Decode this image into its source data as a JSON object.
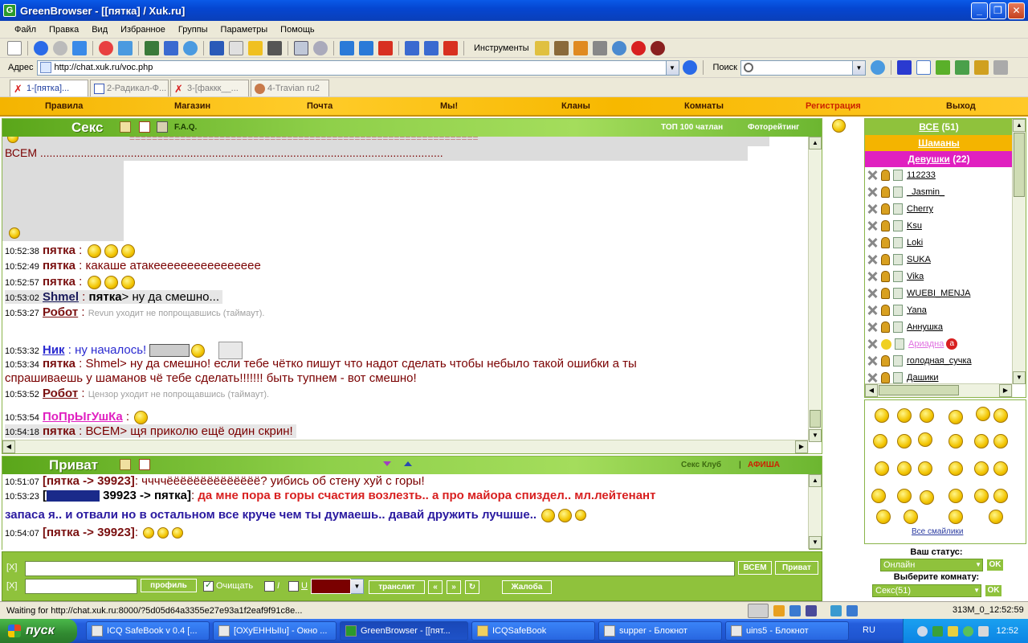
{
  "window": {
    "title": "GreenBrowser - [[пятка] / Xuk.ru]",
    "app_icon": "G"
  },
  "menu": [
    "Файл",
    "Правка",
    "Вид",
    "Избранное",
    "Группы",
    "Параметры",
    "Помощь"
  ],
  "toolbar": {
    "tools_label": "Инструменты"
  },
  "address": {
    "label": "Адрес",
    "url": "http://chat.xuk.ru/voc.php",
    "search_label": "Поиск"
  },
  "tabs": [
    "1-[пятка]...",
    "2-Радикал-Ф...",
    "3-[факкк__...",
    "4-Travian ru2"
  ],
  "topnav": [
    "Правила",
    "Магазин",
    "Почта",
    "Мы!",
    "Кланы",
    "Комнаты",
    "Регистрация",
    "Выход"
  ],
  "room": {
    "title": "Секс",
    "faq": "F.A.Q.",
    "top": "ТОП 100 чатлан",
    "photo": "Фоторейтинг"
  },
  "chat": {
    "separator": "==============================================================",
    "all_line": "ВСЕМ .................................................................................................................................",
    "messages": [
      {
        "time": "10:52:38",
        "nick": "пятка",
        "text": ""
      },
      {
        "time": "10:52:49",
        "nick": "пятка",
        "text": "какаше атакееееееееееееееее"
      },
      {
        "time": "10:52:57",
        "nick": "пятка",
        "text": ""
      },
      {
        "time": "10:53:02",
        "nick": "Shmel",
        "to": "пятка",
        "text": "ну да смешно..."
      },
      {
        "time": "10:53:27",
        "nick": "Робот",
        "text": "Revun уходит не попрощавшись (таймаут)."
      },
      {
        "time": "10:53:32",
        "nick": "Ник",
        "text": "ну началось!"
      },
      {
        "time": "10:53:34",
        "nick": "пятка",
        "text": "Shmel> ну да смешно! если тебе чётко пишут что надот сделать чтобы небыло такой ошибки а ты"
      },
      {
        "time": "",
        "nick": "",
        "text": "спрашиваешь у шаманов чё тебе сделать!!!!!!! быть тупнем - вот смешно!"
      },
      {
        "time": "10:53:52",
        "nick": "Робот",
        "text": "Цензор уходит не попрощавшись (таймаут)."
      },
      {
        "time": "10:53:54",
        "nick": "ПоПрЫгУшКа",
        "text": ""
      },
      {
        "time": "10:54:18",
        "nick": "пятка",
        "text": "ВСЕМ> щя приколю ещё один скрин!"
      }
    ]
  },
  "private": {
    "title": "Приват",
    "club": "Секс Клуб",
    "afisha": "АФИША",
    "messages": [
      {
        "time": "10:51:07",
        "head": "[пятка -> 39923]",
        "text": "ччччёёёёёёёёёёёёёё? уибись об стену хуй с горы!"
      },
      {
        "time": "10:53:23",
        "head": "39923 -> пятка]",
        "text": "да мне пора в горы счастия возлезть.. а про майора спиздел.. мл.лейтенант"
      },
      {
        "time": "",
        "head": "",
        "text": "запаса я.. и отвали но в остальном все круче чем ты думаешь.. давай дружить лучшше.."
      },
      {
        "time": "10:54:07",
        "head": "[пятка -> 39923]",
        "text": ""
      }
    ]
  },
  "input": {
    "x_label": "[X]",
    "all_btn": "ВСЕМ",
    "priv_btn": "Приват",
    "profile_btn": "профиль",
    "clear_label": "Очищать",
    "italic_label": "I",
    "underline_label": "U",
    "translit_btn": "транслит",
    "prev_btn": "«",
    "next_btn": "»",
    "complain_btn": "Жалоба"
  },
  "users": {
    "all": "ВСЕ",
    "all_count": "(51)",
    "shamans": "Шаманы",
    "girls": "Девушки",
    "girls_count": "(22)",
    "list": [
      "112233",
      "_Jasmin_",
      "Cherry",
      "Ksu",
      "Loki",
      "SUKA",
      "Vika",
      "WUEBI_MENJA",
      "Yana",
      "Аннушка",
      "Ариадна",
      "голодная_сучка",
      "Дашики"
    ]
  },
  "smiles": {
    "all_link": "Все смайлики"
  },
  "status": {
    "label": "Ваш статус:",
    "value": "Онлайн",
    "room_label": "Выберите комнату:",
    "room_value": "Секс(51)",
    "ok": "OK"
  },
  "statusbar": {
    "text": "Waiting for http://chat.xuk.ru:8000/?5d05d64a3355e27e93a1f2eaf9f91c8e...",
    "info": "313M_0_12:52:59"
  },
  "taskbar": {
    "start": "пуск",
    "tasks": [
      "ICQ SafeBook v 0.4 [...",
      "[ОХуЕННЫIu] - Окно ...",
      "GreenBrowser - [[пят...",
      "ICQSafeBook",
      "supper - Блокнот",
      "uins5 - Блокнот"
    ],
    "lang": "RU",
    "clock": "12:52"
  },
  "colors": {
    "accent_green": "#8fc23c",
    "nav_yellow": "#ffcc2a",
    "nick_red": "#7a1010"
  }
}
